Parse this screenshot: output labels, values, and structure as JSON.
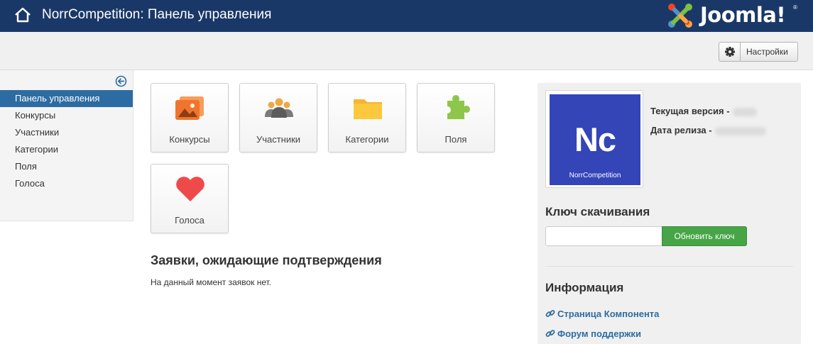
{
  "header": {
    "title": "NorrCompetition: Панель управления",
    "logo_text": "Joomla!",
    "logo_reg": "®",
    "bar_color": "#1a3867"
  },
  "toolbar": {
    "settings_label": "Настройки",
    "settings_icon": "gear-icon"
  },
  "sidebar": {
    "collapse_icon": "collapse-left-arrow-icon",
    "items": [
      {
        "label": "Панель управления",
        "active": true
      },
      {
        "label": "Конкурсы",
        "active": false
      },
      {
        "label": "Участники",
        "active": false
      },
      {
        "label": "Категории",
        "active": false
      },
      {
        "label": "Поля",
        "active": false
      },
      {
        "label": "Голоса",
        "active": false
      }
    ],
    "active_color": "#2d6ca2"
  },
  "tiles": [
    {
      "label": "Конкурсы",
      "icon": "images-icon",
      "color": "#f0742c"
    },
    {
      "label": "Участники",
      "icon": "users-icon",
      "color": "#f0a742"
    },
    {
      "label": "Категории",
      "icon": "folder-icon",
      "color": "#fcc93e"
    },
    {
      "label": "Поля",
      "icon": "puzzle-icon",
      "color": "#8dc64a"
    },
    {
      "label": "Голоса",
      "icon": "heart-icon",
      "color": "#ef4a4a"
    }
  ],
  "pending": {
    "heading": "Заявки, ожидающие подтверждения",
    "empty_text": "На данный момент заявок нет."
  },
  "panel": {
    "component_logo": {
      "abbr": "Nc",
      "name": "NorrCompetition",
      "color": "#3445b7"
    },
    "current_version_label": "Текущая версия -",
    "release_date_label": "Дата релиза -",
    "key_heading": "Ключ скачивания",
    "key_input_value": "",
    "key_input_placeholder": "",
    "update_key_label": "Обновить ключ",
    "update_key_color": "#46a546",
    "info_heading": "Информация",
    "links": [
      {
        "label": "Страница Компонента",
        "icon": "link-icon"
      },
      {
        "label": "Форум поддержки",
        "icon": "link-icon"
      }
    ],
    "link_color": "#2d6ca2"
  }
}
